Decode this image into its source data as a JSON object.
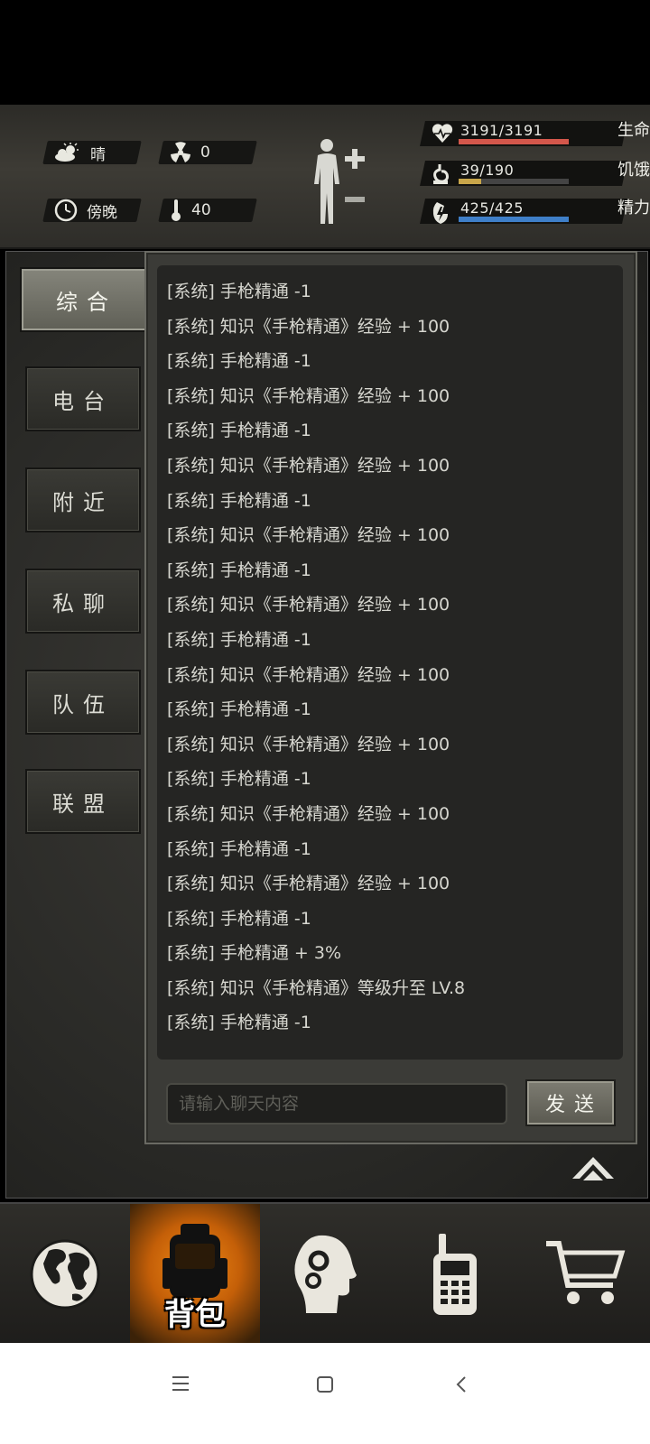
{
  "status": {
    "weather": {
      "icon": "cloud-sun-icon",
      "label": "晴"
    },
    "radiation": {
      "icon": "radiation-icon",
      "value": "0"
    },
    "time_of_day": {
      "icon": "clock-icon",
      "label": "傍晚"
    },
    "temperature": {
      "icon": "thermometer-icon",
      "value": "40"
    },
    "health": {
      "value": "3191/3191",
      "label": "生命",
      "fraction": 1.0,
      "color": "#d4574b"
    },
    "hunger": {
      "value": "39/190",
      "label": "饥饿",
      "fraction": 0.205,
      "color": "#c9a64a"
    },
    "energy": {
      "value": "425/425",
      "label": "精力",
      "fraction": 1.0,
      "color": "#3f7fc8"
    }
  },
  "tabs": [
    {
      "label": "综合",
      "active": true
    },
    {
      "label": "电台",
      "active": false
    },
    {
      "label": "附近",
      "active": false
    },
    {
      "label": "私聊",
      "active": false
    },
    {
      "label": "队伍",
      "active": false
    },
    {
      "label": "联盟",
      "active": false
    }
  ],
  "chat": {
    "messages": [
      "[系统] 手枪精通 -1",
      "[系统] 知识《手枪精通》经验 + 100",
      "[系统] 手枪精通 -1",
      "[系统] 知识《手枪精通》经验 + 100",
      "[系统] 手枪精通 -1",
      "[系统] 知识《手枪精通》经验 + 100",
      "[系统] 手枪精通 -1",
      "[系统] 知识《手枪精通》经验 + 100",
      "[系统] 手枪精通 -1",
      "[系统] 知识《手枪精通》经验 + 100",
      "[系统] 手枪精通 -1",
      "[系统] 知识《手枪精通》经验 + 100",
      "[系统] 手枪精通 -1",
      "[系统] 知识《手枪精通》经验 + 100",
      "[系统] 手枪精通 -1",
      "[系统] 知识《手枪精通》经验 + 100",
      "[系统] 手枪精通 -1",
      "[系统] 知识《手枪精通》经验 + 100",
      "[系统] 手枪精通 -1",
      "[系统] 手枪精通 + 3%",
      "[系统] 知识《手枪精通》等级升至 LV.8",
      "[系统] 手枪精通 -1"
    ],
    "input_placeholder": "请输入聊天内容",
    "send_label": "发送"
  },
  "bottom_nav": [
    {
      "icon": "globe-icon",
      "label": "",
      "active": false
    },
    {
      "icon": "backpack-icon",
      "label": "背包",
      "active": true
    },
    {
      "icon": "head-gears-icon",
      "label": "",
      "active": false
    },
    {
      "icon": "walkie-talkie-icon",
      "label": "",
      "active": false
    },
    {
      "icon": "shopping-cart-icon",
      "label": "",
      "active": false
    }
  ],
  "system_nav": [
    "menu-icon",
    "home-icon",
    "back-icon"
  ]
}
